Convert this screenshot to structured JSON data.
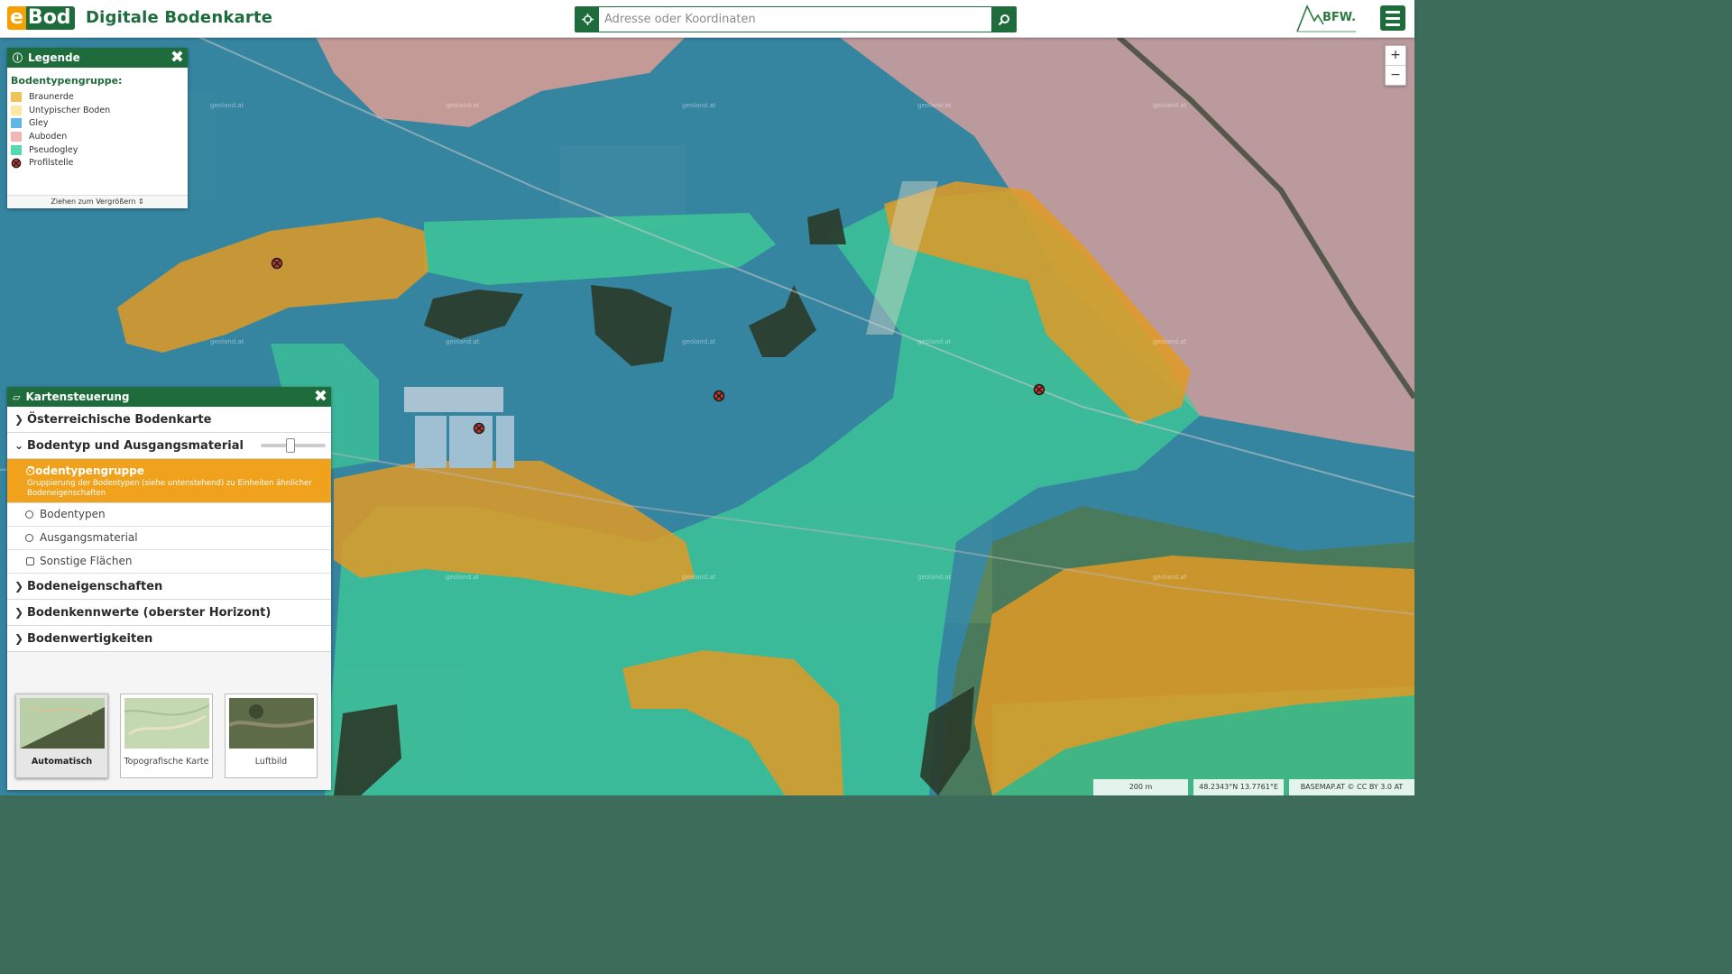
{
  "header": {
    "logo_e": "e",
    "logo_bod": "Bod",
    "title": "Digitale Bodenkarte",
    "search_placeholder": "Adresse oder Koordinaten",
    "partner_logo_text": "BFW."
  },
  "map": {
    "watermark": "geoland.at",
    "zoom_in": "+",
    "zoom_out": "−"
  },
  "legend": {
    "title": "Legende",
    "section": "Bodentypengruppe:",
    "items": [
      {
        "label": "Braunerde",
        "color": "#f0c25a"
      },
      {
        "label": "Untypischer Boden",
        "color": "#fbe7a6"
      },
      {
        "label": "Gley",
        "color": "#5fb8e8"
      },
      {
        "label": "Auboden",
        "color": "#f2b6b6"
      },
      {
        "label": "Pseudogley",
        "color": "#55d9b0"
      },
      {
        "label": "Profilstelle",
        "color": "#c0392b"
      }
    ],
    "resize_hint": "Ziehen zum Vergrößern"
  },
  "control": {
    "title": "Kartensteuerung",
    "sections": [
      "Österreichische Bodenkarte",
      "Bodentyp und Ausgangsmaterial",
      "Bodeneigenschaften",
      "Bodenkennwerte (oberster Horizont)",
      "Bodenwertigkeiten"
    ],
    "options": {
      "active_label": "Bodentypengruppe",
      "active_desc": "Gruppierung der Bodentypen (siehe untenstehend) zu Einheiten ähnlicher Bodeneigenschaften",
      "bodentypen": "Bodentypen",
      "ausgangsmaterial": "Ausgangsmaterial",
      "sonstige": "Sonstige Flächen"
    },
    "opacity_slider_fraction": 0.45,
    "basemaps": [
      "Automatisch",
      "Topografische Karte",
      "Luftbild"
    ]
  },
  "footer": {
    "scale": "200 m",
    "coords": "48.2343°N 13.7761°E",
    "attribution": "BASEMAP.AT © CC BY 3.0 AT"
  },
  "colors": {
    "brand_green": "#1e6b3b",
    "accent_orange": "#f0a21d"
  }
}
